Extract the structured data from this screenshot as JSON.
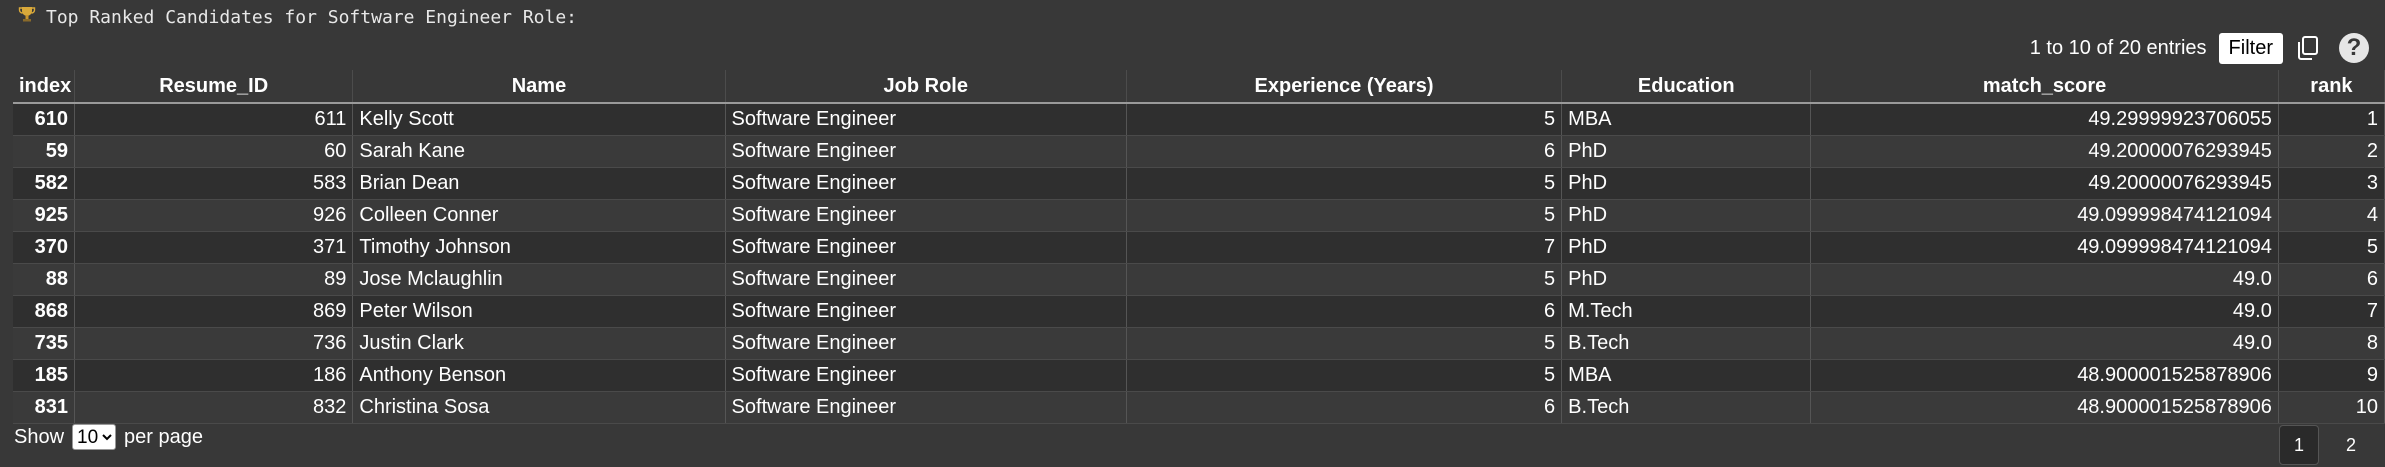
{
  "title": "Top Ranked Candidates for Software Engineer Role:",
  "topbar": {
    "entries_text": "1 to 10 of 20 entries",
    "filter_label": "Filter",
    "help_label": "?"
  },
  "table": {
    "columns": [
      "index",
      "Resume_ID",
      "Name",
      "Job Role",
      "Experience (Years)",
      "Education",
      "match_score",
      "rank"
    ],
    "rows": [
      [
        "610",
        "611",
        "Kelly Scott",
        "Software Engineer",
        "5",
        "MBA",
        "49.29999923706055",
        "1"
      ],
      [
        "59",
        "60",
        "Sarah Kane",
        "Software Engineer",
        "6",
        "PhD",
        "49.20000076293945",
        "2"
      ],
      [
        "582",
        "583",
        "Brian Dean",
        "Software Engineer",
        "5",
        "PhD",
        "49.20000076293945",
        "3"
      ],
      [
        "925",
        "926",
        "Colleen Conner",
        "Software Engineer",
        "5",
        "PhD",
        "49.099998474121094",
        "4"
      ],
      [
        "370",
        "371",
        "Timothy Johnson",
        "Software Engineer",
        "7",
        "PhD",
        "49.099998474121094",
        "5"
      ],
      [
        "88",
        "89",
        "Jose Mclaughlin",
        "Software Engineer",
        "5",
        "PhD",
        "49.0",
        "6"
      ],
      [
        "868",
        "869",
        "Peter Wilson",
        "Software Engineer",
        "6",
        "M.Tech",
        "49.0",
        "7"
      ],
      [
        "735",
        "736",
        "Justin Clark",
        "Software Engineer",
        "5",
        "B.Tech",
        "49.0",
        "8"
      ],
      [
        "185",
        "186",
        "Anthony Benson",
        "Software Engineer",
        "5",
        "MBA",
        "48.900001525878906",
        "9"
      ],
      [
        "831",
        "832",
        "Christina Sosa",
        "Software Engineer",
        "6",
        "B.Tech",
        "48.900001525878906",
        "10"
      ]
    ]
  },
  "footer": {
    "show_label": "Show",
    "per_page_value": "10",
    "per_page_label": "per page",
    "pages": [
      "1",
      "2"
    ],
    "current_page": "1"
  }
}
